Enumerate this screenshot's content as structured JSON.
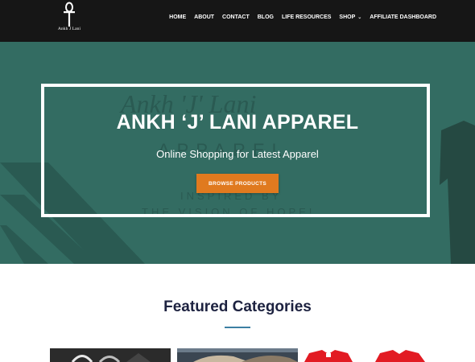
{
  "header": {
    "logo_text": "Ankh J Lani",
    "nav": [
      {
        "label": "HOME"
      },
      {
        "label": "ABOUT"
      },
      {
        "label": "CONTACT"
      },
      {
        "label": "BLOG"
      },
      {
        "label": "LIFE RESOURCES"
      },
      {
        "label": "SHOP",
        "has_dropdown": true
      },
      {
        "label": "AFFILIATE DASHBOARD"
      }
    ]
  },
  "hero": {
    "title": "ANKH ‘J’ LANI APPAREL",
    "subtitle": "Online Shopping for Latest Apparel",
    "button_label": "BROWSE PRODUCTS",
    "background_script_text": "Ankh 'J' Lani",
    "background_word": "APPAREL",
    "background_line1": "INSPIRED BY",
    "background_line2": "THE VISION OF HOPE!"
  },
  "featured": {
    "title": "Featured Categories",
    "categories": [
      {
        "icon": "sandals-image"
      },
      {
        "icon": "shoes-image"
      },
      {
        "icon": "red-shirts-image"
      }
    ]
  },
  "colors": {
    "header_bg": "#161616",
    "hero_bg": "#336c62",
    "button": "#e07a1f",
    "title": "#1d2240",
    "accent": "#3c7fa3"
  }
}
